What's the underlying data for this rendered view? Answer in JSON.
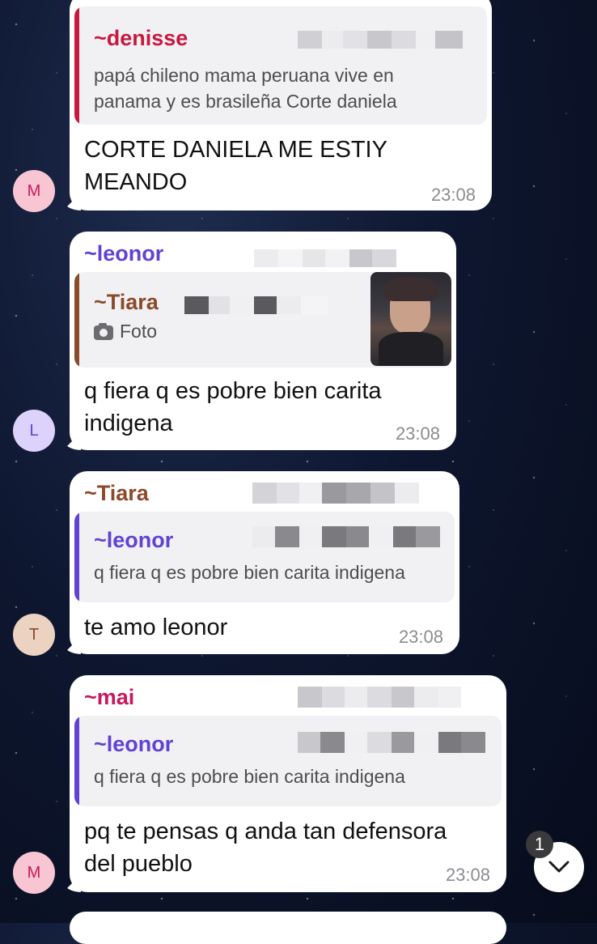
{
  "colors": {
    "denisse": "#c8183f",
    "leonor": "#6142d4",
    "tiara": "#8b4a28",
    "mai": "#c8185e"
  },
  "messages": [
    {
      "avatar_letter": "M",
      "quote_name": "~denisse",
      "quote_text_1": "papá chileno mama peruana vive en",
      "quote_text_2": "panama y es brasileña Corte daniela",
      "text_1": "CORTE DANIELA ME ESTIY",
      "text_2": "MEANDO",
      "time": "23:08"
    },
    {
      "avatar_letter": "L",
      "sender": "~leonor",
      "quote_name": "~Tiara",
      "quote_media_label": "Foto",
      "text_1": "q fiera q es pobre bien carita",
      "text_2": "indigena",
      "time": "23:08"
    },
    {
      "avatar_letter": "T",
      "sender": "~Tiara",
      "quote_name": "~leonor",
      "quote_text": "q fiera q es pobre bien carita indigena",
      "text": "te amo leonor",
      "time": "23:08"
    },
    {
      "avatar_letter": "M",
      "sender": "~mai",
      "quote_name": "~leonor",
      "quote_text": "q fiera q es pobre bien carita indigena",
      "text_1": "pq te pensas q anda tan defensora",
      "text_2": "del pueblo",
      "time": "23:08"
    }
  ],
  "scroll": {
    "unread_count": "1"
  }
}
